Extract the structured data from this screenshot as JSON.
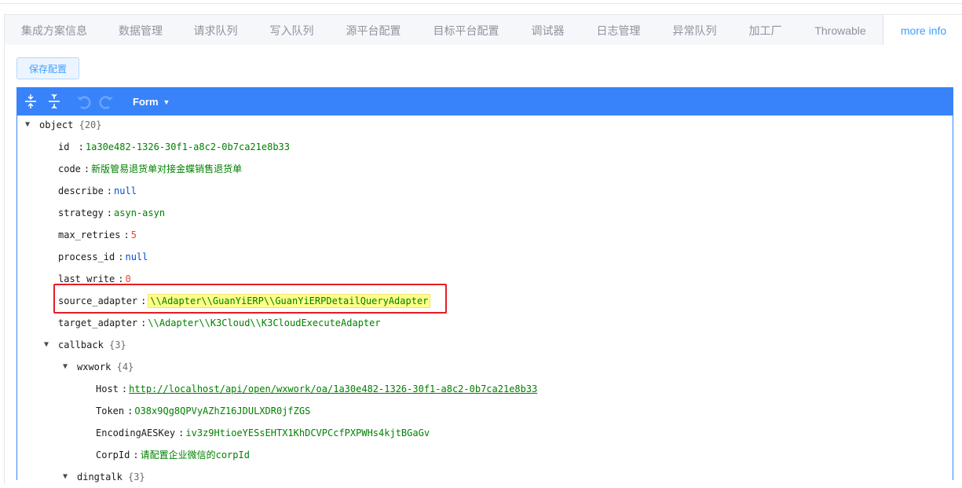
{
  "tabs": [
    {
      "label": "集成方案信息",
      "active": false
    },
    {
      "label": "数据管理",
      "active": false
    },
    {
      "label": "请求队列",
      "active": false
    },
    {
      "label": "写入队列",
      "active": false
    },
    {
      "label": "源平台配置",
      "active": false
    },
    {
      "label": "目标平台配置",
      "active": false
    },
    {
      "label": "调试器",
      "active": false
    },
    {
      "label": "日志管理",
      "active": false
    },
    {
      "label": "异常队列",
      "active": false
    },
    {
      "label": "加工厂",
      "active": false
    },
    {
      "label": "Throwable",
      "active": false
    },
    {
      "label": "more info",
      "active": true
    }
  ],
  "toolbar": {
    "save_label": "保存配置"
  },
  "editor": {
    "mode_label": "Form",
    "menu_icons": [
      "expand-all-icon",
      "collapse-all-icon",
      "undo-icon",
      "redo-icon"
    ],
    "accent": "#3883fa",
    "root": {
      "key": "object",
      "count": "{20}"
    },
    "fields": {
      "id": {
        "key": "id",
        "value": "1a30e482-1326-30f1-a8c2-0b7ca21e8b33"
      },
      "code": {
        "key": "code",
        "value": "新版管易退货单对接金蝶销售退货单"
      },
      "describe": {
        "key": "describe",
        "value": "null"
      },
      "strategy": {
        "key": "strategy",
        "value": "asyn-asyn"
      },
      "max_retries": {
        "key": "max_retries",
        "value": "5"
      },
      "process_id": {
        "key": "process_id",
        "value": "null"
      },
      "last_write": {
        "key": "last_write",
        "value": "0"
      },
      "source_adapter": {
        "key": "source_adapter",
        "value": "\\\\Adapter\\\\GuanYiERP\\\\GuanYiERPDetailQueryAdapter"
      },
      "target_adapter": {
        "key": "target_adapter",
        "value": "\\\\Adapter\\\\K3Cloud\\\\K3CloudExecuteAdapter"
      }
    },
    "callback": {
      "key": "callback",
      "count": "{3}",
      "wxwork": {
        "key": "wxwork",
        "count": "{4}",
        "host": {
          "key": "Host",
          "value": "http://localhost/api/open/wxwork/oa/1a30e482-1326-30f1-a8c2-0b7ca21e8b33"
        },
        "token": {
          "key": "Token",
          "value": "O38x9Qg8QPVyAZhZ16JDULXDR0jfZGS"
        },
        "aeskey": {
          "key": "EncodingAESKey",
          "value": "iv3z9HtioeYESsEHTX1KhDCVPCcfPXPWHs4kjtBGaGv"
        },
        "corpid": {
          "key": "CorpId",
          "value": "请配置企业微信的corpId"
        }
      },
      "dingtalk": {
        "key": "dingtalk",
        "count": "{3}"
      }
    }
  },
  "highlight": {
    "field": "source_adapter",
    "box_color": "#e51c23",
    "value_bg": "#ffff88"
  }
}
